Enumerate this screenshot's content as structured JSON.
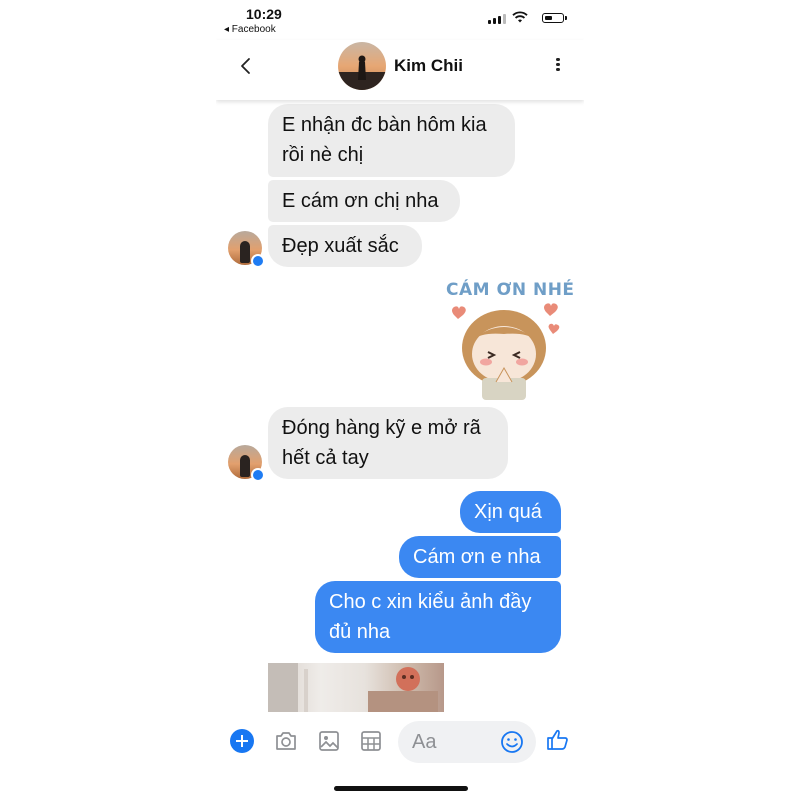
{
  "status_bar": {
    "time": "10:29",
    "back_app": "◂ Facebook"
  },
  "header": {
    "contact_name": "Kim Chii",
    "back_icon": "chevron-left-icon",
    "more_icon": "vertical-ellipsis-icon"
  },
  "messages": [
    {
      "side": "in",
      "text": "E nhận đc bàn hôm kia rồi nè chị"
    },
    {
      "side": "in",
      "text": "E cám ơn chị nha"
    },
    {
      "side": "in",
      "text": "Đẹp xuất sắc"
    },
    {
      "side": "out",
      "type": "sticker",
      "text": "CÁM ƠN NHÉ"
    },
    {
      "side": "in",
      "text": "Đóng hàng kỹ e mở rã hết cả tay"
    },
    {
      "side": "out",
      "text": "Xịn quá"
    },
    {
      "side": "out",
      "text": "Cám ơn e nha"
    },
    {
      "side": "out",
      "text": "Cho c xin kiểu ảnh đầy đủ nha"
    },
    {
      "side": "in",
      "type": "photo"
    }
  ],
  "composer": {
    "placeholder": "Aa",
    "icons": [
      "plus-icon",
      "camera-icon",
      "gallery-icon",
      "grid-icon",
      "emoji-icon",
      "like-icon"
    ]
  },
  "colors": {
    "outgoing_bubble": "#3b88f2",
    "incoming_bubble": "#ececec",
    "accent": "#1877f2"
  }
}
